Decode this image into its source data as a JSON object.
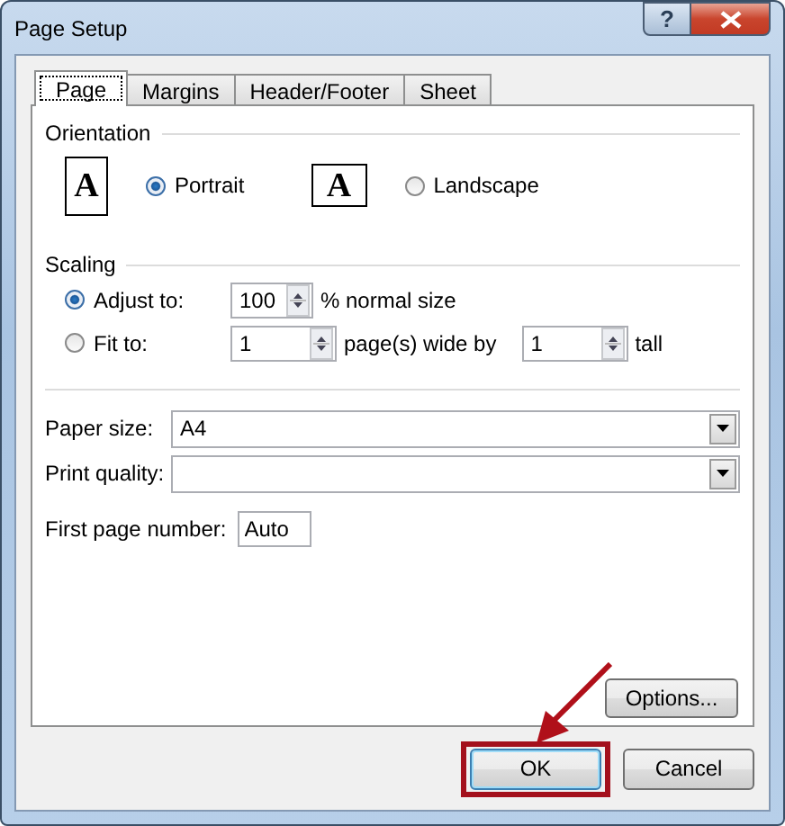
{
  "window": {
    "title": "Page Setup",
    "help": "?"
  },
  "tabs": [
    {
      "label": "Page",
      "selected": true
    },
    {
      "label": "Margins",
      "selected": false
    },
    {
      "label": "Header/Footer",
      "selected": false
    },
    {
      "label": "Sheet",
      "selected": false
    }
  ],
  "orientation": {
    "label": "Orientation",
    "options": [
      {
        "label": "Portrait",
        "selected": true,
        "kind": "portrait",
        "glyph": "A"
      },
      {
        "label": "Landscape",
        "selected": false,
        "kind": "landscape",
        "glyph": "A"
      }
    ]
  },
  "scaling": {
    "label": "Scaling",
    "options": [
      {
        "kind": "adjust",
        "label": "Adjust to:",
        "selected": true,
        "value": "100",
        "suffix": "% normal size"
      },
      {
        "kind": "fit",
        "label": "Fit to:",
        "selected": false,
        "value": "1",
        "suffix": "page(s) wide by",
        "value_2": "1",
        "suffix_2": "tall"
      }
    ]
  },
  "paper_size": {
    "label": "Paper size:",
    "value": "A4"
  },
  "print_quality": {
    "label": "Print quality:"
  },
  "first_page_number": {
    "label": "First page number:",
    "value": "Auto"
  },
  "options_button": "Options...",
  "buttons": [
    {
      "label": "OK",
      "highlighted": true
    },
    {
      "label": "Cancel",
      "highlighted": false
    }
  ]
}
